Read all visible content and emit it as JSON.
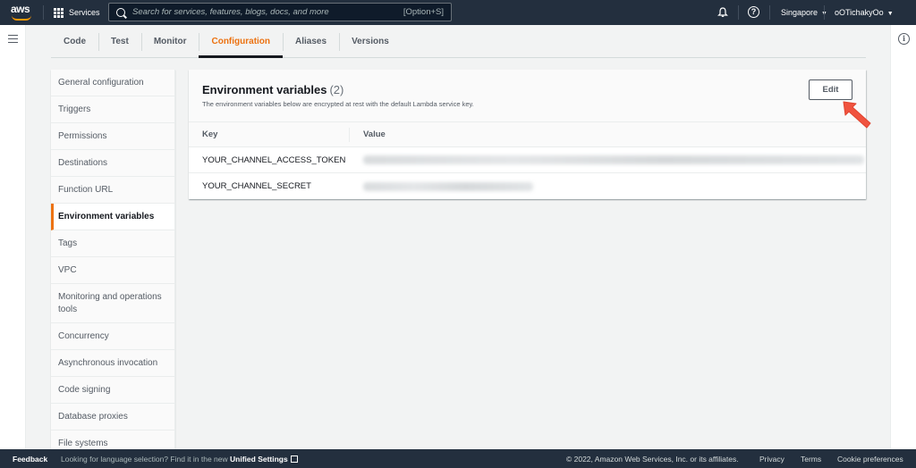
{
  "topnav": {
    "logo": "aws",
    "services_label": "Services",
    "search_placeholder": "Search for services, features, blogs, docs, and more",
    "search_shortcut": "[Option+S]",
    "region": "Singapore",
    "account": "oOTichakyOo"
  },
  "tabs": [
    {
      "label": "Code",
      "active": false
    },
    {
      "label": "Test",
      "active": false
    },
    {
      "label": "Monitor",
      "active": false
    },
    {
      "label": "Configuration",
      "active": true
    },
    {
      "label": "Aliases",
      "active": false
    },
    {
      "label": "Versions",
      "active": false
    }
  ],
  "sidemenu": {
    "items": [
      {
        "label": "General configuration"
      },
      {
        "label": "Triggers"
      },
      {
        "label": "Permissions"
      },
      {
        "label": "Destinations"
      },
      {
        "label": "Function URL"
      },
      {
        "label": "Environment variables",
        "active": true
      },
      {
        "label": "Tags"
      },
      {
        "label": "VPC"
      },
      {
        "label": "Monitoring and operations tools"
      },
      {
        "label": "Concurrency"
      },
      {
        "label": "Asynchronous invocation"
      },
      {
        "label": "Code signing"
      },
      {
        "label": "Database proxies"
      },
      {
        "label": "File systems"
      }
    ]
  },
  "env": {
    "title": "Environment variables",
    "count": "(2)",
    "description": "The environment variables below are encrypted at rest with the default Lambda service key.",
    "edit_label": "Edit",
    "columns": {
      "key": "Key",
      "value": "Value"
    },
    "rows": [
      {
        "key": "YOUR_CHANNEL_ACCESS_TOKEN",
        "value_redacted": true
      },
      {
        "key": "YOUR_CHANNEL_SECRET",
        "value_redacted": true
      }
    ]
  },
  "footer": {
    "feedback": "Feedback",
    "language_text": "Looking for language selection? Find it in the new",
    "unified_settings": "Unified Settings",
    "copyright": "© 2022, Amazon Web Services, Inc. or its affiliates.",
    "privacy": "Privacy",
    "terms": "Terms",
    "cookie": "Cookie preferences"
  },
  "colors": {
    "nav_bg": "#232f3e",
    "accent": "#ec7211",
    "annotation_arrow": "#f0533f"
  }
}
